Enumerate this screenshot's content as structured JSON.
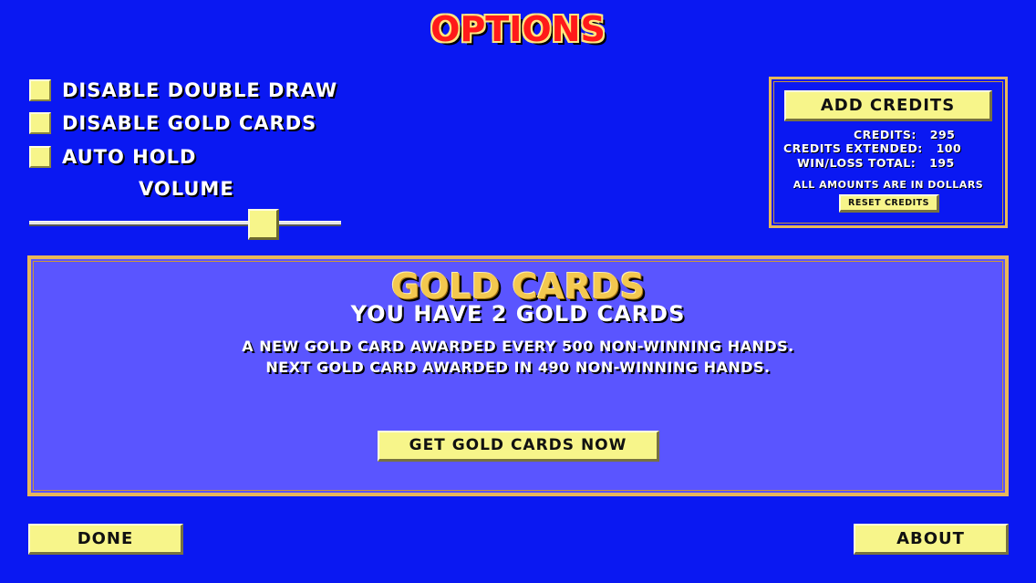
{
  "screen": {
    "title": "OPTIONS",
    "background_color": "#0a18f2",
    "accent_color": "#f7f58a",
    "border_color": "#e8b75a"
  },
  "options": [
    {
      "label": "DISABLE DOUBLE DRAW",
      "checked": false
    },
    {
      "label": "DISABLE GOLD CARDS",
      "checked": false
    },
    {
      "label": "AUTO HOLD",
      "checked": false
    }
  ],
  "volume": {
    "label": "VOLUME",
    "level_fraction": 0.78
  },
  "credits_panel": {
    "add_credits_label": "ADD CREDITS",
    "credits_label": "CREDITS:",
    "credits_value": "295",
    "credits_extended_label": "CREDITS EXTENDED:",
    "credits_extended_value": "100",
    "win_loss_label": "WIN/LOSS TOTAL:",
    "win_loss_value": "195",
    "note": "ALL AMOUNTS ARE IN DOLLARS",
    "reset_label": "RESET CREDITS"
  },
  "gold_cards": {
    "title": "GOLD CARDS",
    "count_text": "YOU HAVE 2 GOLD CARDS",
    "info_line_1": "A NEW GOLD CARD AWARDED EVERY 500 NON-WINNING HANDS.",
    "info_line_2": "NEXT GOLD CARD AWARDED IN 490 NON-WINNING HANDS.",
    "get_button_label": "GET GOLD CARDS NOW"
  },
  "footer": {
    "done_label": "DONE",
    "about_label": "ABOUT"
  }
}
